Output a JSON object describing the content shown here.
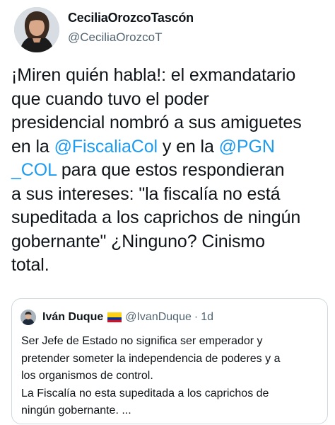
{
  "author": {
    "name": "CeciliaOrozcoTascón",
    "handle": "@CeciliaOrozcoT"
  },
  "tweet": {
    "line1": "¡Miren quién habla!: el exmandatario",
    "line2": "que cuando tuvo el poder",
    "line3": "presidencial nombró a sus amiguetes",
    "line4_prefix": "en la ",
    "line4_mention1": "@FiscaliaCol",
    "line4_mid": " y en la ",
    "line4_mention2": "@PGN",
    "line5_mention": "_COL",
    "line5_suffix": " para que estos respondieran",
    "line6": "a sus intereses: \"la fiscalía no está",
    "line7": "supeditada a los caprichos de ningún",
    "line8": "gobernante\" ¿Ninguno? Cinismo",
    "line9": "total."
  },
  "quote": {
    "name": "Iván Duque",
    "handle": "@IvanDuque",
    "separator": "·",
    "time": "1d",
    "line1": "Ser Jefe de Estado no significa ser emperador y",
    "line2": "pretender someter la independencia de poderes y a",
    "line3": "los organismos de control.",
    "line4": "La Fiscalía no esta supeditada  a los caprichos de",
    "line5": "ningún gobernante. ..."
  },
  "colors": {
    "link": "#1d9bf0",
    "secondary_text": "#536471",
    "border": "#cfd9de"
  }
}
